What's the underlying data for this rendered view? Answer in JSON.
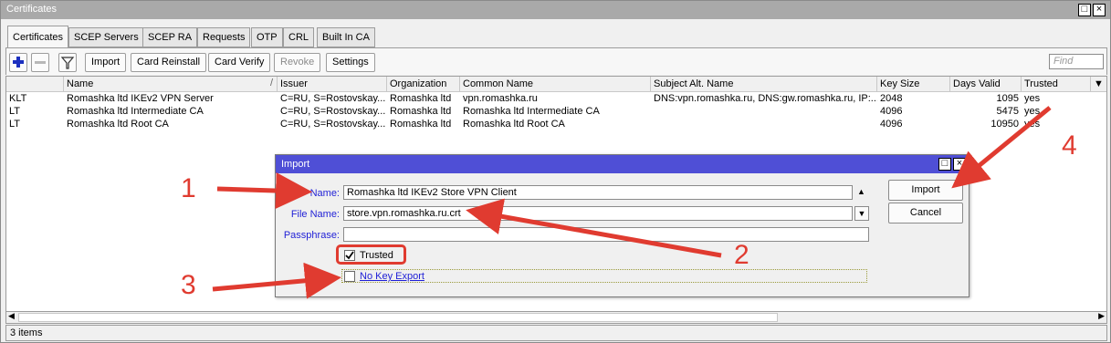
{
  "window": {
    "title": "Certificates"
  },
  "tabs": [
    "Certificates",
    "SCEP Servers",
    "SCEP RA",
    "Requests",
    "OTP",
    "CRL",
    "Built In CA"
  ],
  "toolbar": {
    "import": "Import",
    "card_reinstall": "Card Reinstall",
    "card_verify": "Card Verify",
    "revoke": "Revoke",
    "settings": "Settings",
    "find_placeholder": "Find"
  },
  "table": {
    "columns": [
      "",
      "Name",
      "Issuer",
      "Organization",
      "Common Name",
      "Subject Alt. Name",
      "Key Size",
      "Days Valid",
      "Trusted"
    ],
    "sort_mark": "/",
    "rows": [
      {
        "flags": "KLT",
        "name": "Romashka ltd IKEv2 VPN Server",
        "issuer": "C=RU, S=Rostovskay...",
        "org": "Romashka ltd",
        "cn": "vpn.romashka.ru",
        "san": "DNS:vpn.romashka.ru, DNS:gw.romashka.ru, IP:...",
        "key_size": "2048",
        "days_valid": "1095",
        "trusted": "yes"
      },
      {
        "flags": "LT",
        "name": "Romashka ltd Intermediate CA",
        "issuer": "C=RU, S=Rostovskay...",
        "org": "Romashka ltd",
        "cn": "Romashka ltd Intermediate CA",
        "san": "",
        "key_size": "4096",
        "days_valid": "5475",
        "trusted": "yes"
      },
      {
        "flags": "LT",
        "name": "Romashka ltd Root CA",
        "issuer": "C=RU, S=Rostovskay...",
        "org": "Romashka ltd",
        "cn": "Romashka ltd Root CA",
        "san": "",
        "key_size": "4096",
        "days_valid": "10950",
        "trusted": "yes"
      }
    ]
  },
  "status": {
    "text": "3 items"
  },
  "dialog": {
    "title": "Import",
    "name_label": "Name:",
    "name_value": "Romashka ltd IKEv2 Store VPN Client",
    "file_label": "File Name:",
    "file_value": "store.vpn.romashka.ru.crt",
    "pass_label": "Passphrase:",
    "pass_value": "",
    "trusted_label": "Trusted",
    "trusted_checked": true,
    "nokey_label": "No Key Export",
    "nokey_checked": false,
    "import_btn": "Import",
    "cancel_btn": "Cancel"
  },
  "annotations": {
    "n1": "1",
    "n2": "2",
    "n3": "3",
    "n4": "4",
    "color": "#e03b30"
  },
  "colors": {
    "dialog_title": "#4f4fd6",
    "label": "#1f1fd6",
    "titlebar": "#a9a9a9"
  }
}
